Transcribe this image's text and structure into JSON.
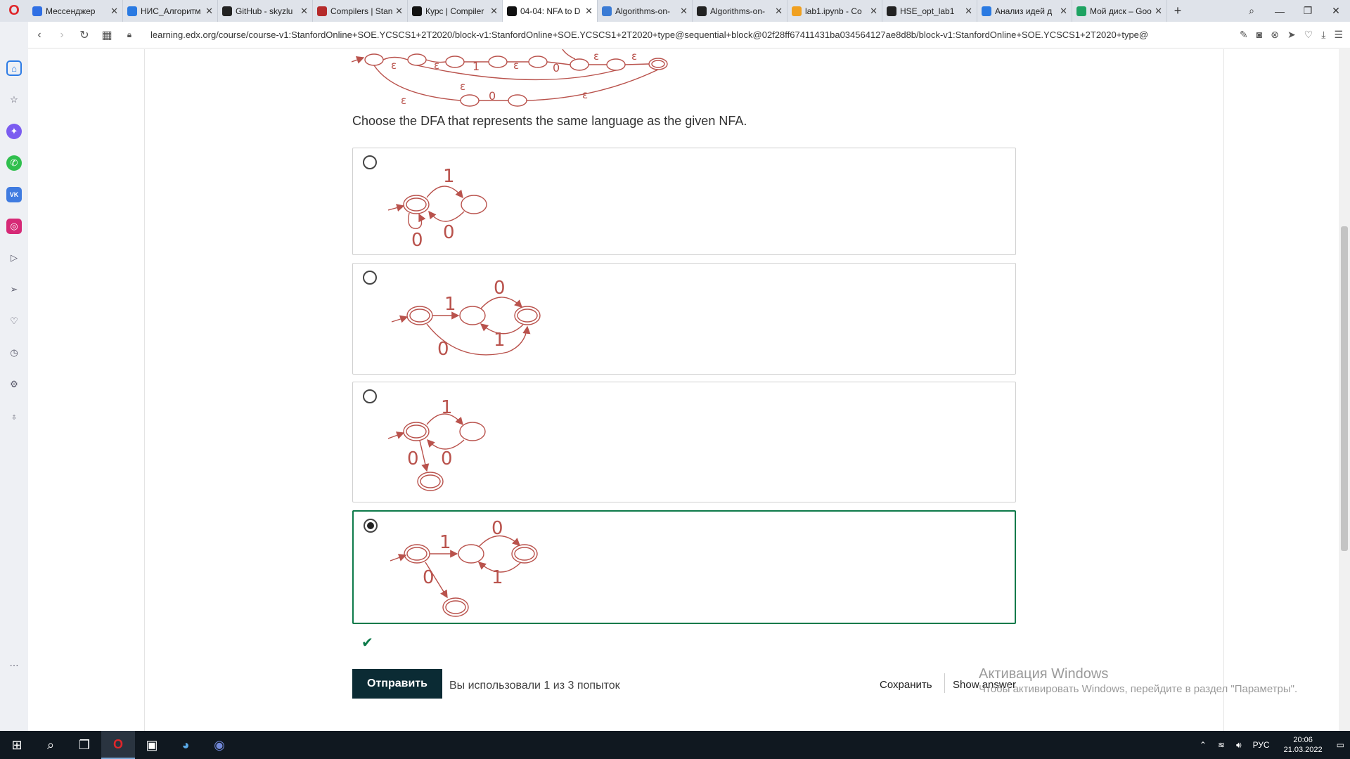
{
  "browser": {
    "tabs": [
      {
        "label": "Мессенджер",
        "fav_color": "#2f6fe4"
      },
      {
        "label": "НИС_Алгоритм",
        "fav_color": "#2a7ae2"
      },
      {
        "label": "GitHub - skyzlu",
        "fav_color": "#222222"
      },
      {
        "label": "Compilers | Stan",
        "fav_color": "#b52a2a"
      },
      {
        "label": "Курс | Compiler",
        "fav_color": "#111111"
      },
      {
        "label": "04-04: NFA to D",
        "fav_color": "#111111",
        "active": true
      },
      {
        "label": "Algorithms-on-",
        "fav_color": "#3a7bd5"
      },
      {
        "label": "Algorithms-on-",
        "fav_color": "#222222"
      },
      {
        "label": "lab1.ipynb - Co",
        "fav_color": "#f0a020"
      },
      {
        "label": "HSE_opt_lab1",
        "fav_color": "#222222"
      },
      {
        "label": "Анализ идей д",
        "fav_color": "#2a7ae2"
      },
      {
        "label": "Мой диск – Goo",
        "fav_color": "#1ea362"
      }
    ],
    "url": "learning.edx.org/course/course-v1:StanfordOnline+SOE.YCSCS1+2T2020/block-v1:StanfordOnline+SOE.YCSCS1+2T2020+type@sequential+block@02f28ff67411431ba034564127ae8d8b/block-v1:StanfordOnline+SOE.YCSCS1+2T2020+type@"
  },
  "problem": {
    "question": "Choose the DFA that represents the same language as the given NFA.",
    "nfa_labels": [
      "ε",
      "ε",
      "1",
      "ε",
      "0",
      "ε",
      "ε",
      "ε",
      "ε",
      "0",
      "ε"
    ],
    "options": [
      {
        "labels": [
          "1",
          "0",
          "0"
        ],
        "selected": false
      },
      {
        "labels": [
          "1",
          "0",
          "1",
          "0"
        ],
        "selected": false
      },
      {
        "labels": [
          "1",
          "0",
          "0"
        ],
        "selected": false
      },
      {
        "labels": [
          "1",
          "0",
          "1",
          "0"
        ],
        "selected": true
      }
    ],
    "result_icon": "checkmark-icon",
    "submit_label": "Отправить",
    "attempts_text": "Вы использовали 1 из 3 попыток",
    "save_label": "Сохранить",
    "show_answer_label": "Show answer"
  },
  "watermark": {
    "title": "Активация Windows",
    "subtitle": "Чтобы активировать Windows, перейдите в раздел \"Параметры\"."
  },
  "taskbar": {
    "lang": "РУС",
    "time": "20:06",
    "date": "21.03.2022"
  },
  "colors": {
    "accent": "#0d7a4a",
    "diagram": "#b9524c",
    "submit_bg": "#0b2b34"
  }
}
